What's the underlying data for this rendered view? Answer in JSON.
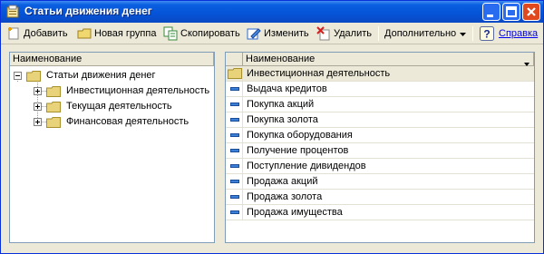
{
  "window": {
    "title": "Статьи движения денег",
    "icon": "folder-app-icon"
  },
  "titlebar_buttons": [
    "minimize-icon",
    "maximize-icon",
    "close-icon"
  ],
  "toolbar": {
    "add_label": "Добавить",
    "new_group_label": "Новая группа",
    "copy_label": "Скопировать",
    "edit_label": "Изменить",
    "delete_label": "Удалить",
    "more_label": "Дополнительно",
    "help_label": "Справка"
  },
  "tree": {
    "header": "Наименование",
    "root": "Статьи движения денег",
    "items": [
      {
        "label": "Инвестиционная деятельность"
      },
      {
        "label": "Текущая деятельность"
      },
      {
        "label": "Финансовая деятельность"
      }
    ]
  },
  "list": {
    "header": "Наименование",
    "group_row": "Инвестиционная деятельность",
    "items": [
      "Выдача кредитов",
      "Покупка акций",
      "Покупка золота",
      "Покупка оборудования",
      "Получение процентов",
      "Поступление дивидендов",
      "Продажа акций",
      "Продажа золота",
      "Продажа имущества"
    ]
  },
  "colors": {
    "titlebar": "#0553d6",
    "link": "#0000ee",
    "item_marker": "#3d7fd6",
    "folder": "#e8d27a"
  }
}
